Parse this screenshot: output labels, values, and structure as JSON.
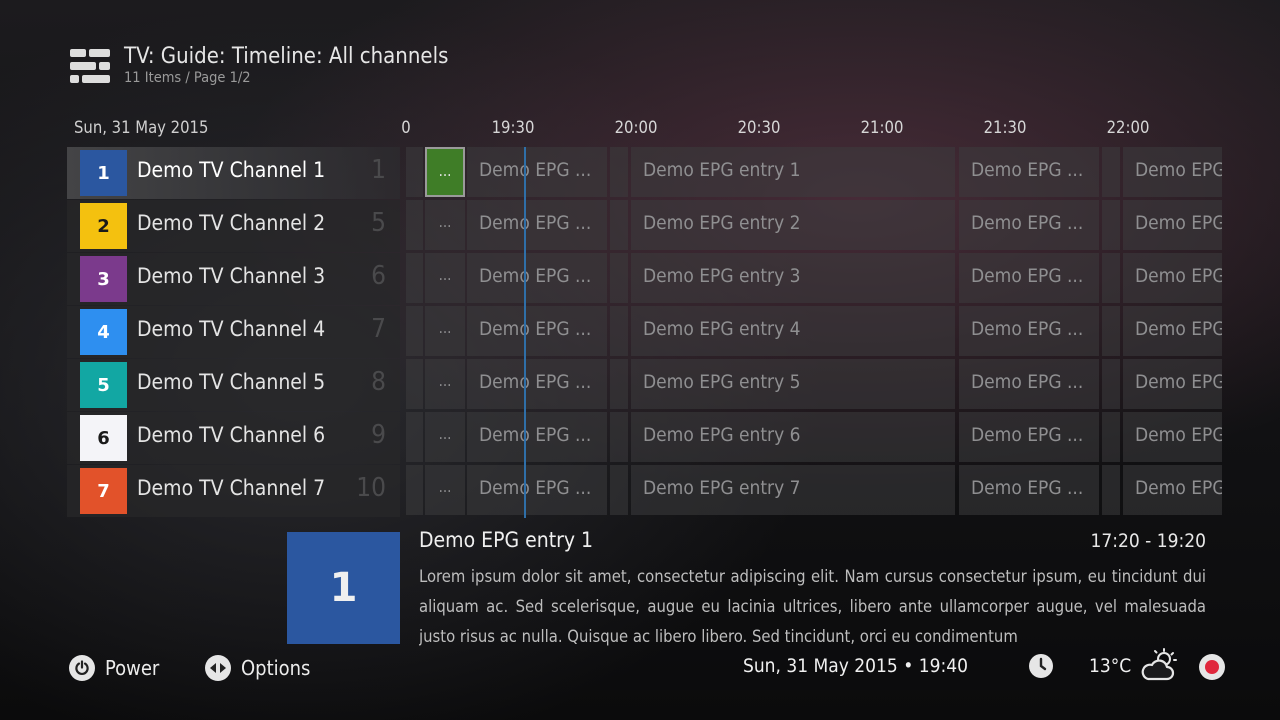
{
  "header": {
    "title": "TV: Guide: Timeline: All channels",
    "subtitle": "11 Items / Page 1/2",
    "icon": "guide-grid-icon"
  },
  "timeline": {
    "date": "Sun, 31 May 2015",
    "ticks": [
      "0",
      "19:30",
      "20:00",
      "20:30",
      "21:00",
      "21:30",
      "22:00"
    ]
  },
  "channels": [
    {
      "badge": "1",
      "name": "Demo TV Channel 1",
      "number": "1",
      "color": "#2b57a0",
      "badge_text_color": "#ffffff"
    },
    {
      "badge": "2",
      "name": "Demo TV Channel 2",
      "number": "5",
      "color": "#f4c10f",
      "badge_text_color": "#1a1a1a"
    },
    {
      "badge": "3",
      "name": "Demo TV Channel 3",
      "number": "6",
      "color": "#7b3a8c",
      "badge_text_color": "#ffffff"
    },
    {
      "badge": "4",
      "name": "Demo TV Channel 4",
      "number": "7",
      "color": "#2e8ff0",
      "badge_text_color": "#ffffff"
    },
    {
      "badge": "5",
      "name": "Demo TV Channel 5",
      "number": "8",
      "color": "#12a7a3",
      "badge_text_color": "#ffffff"
    },
    {
      "badge": "6",
      "name": "Demo TV Channel 6",
      "number": "9",
      "color": "#f4f4f8",
      "badge_text_color": "#1a1a1a"
    },
    {
      "badge": "7",
      "name": "Demo TV Channel 7",
      "number": "10",
      "color": "#e2522a",
      "badge_text_color": "#ffffff"
    }
  ],
  "epg_rows": [
    {
      "cells": [
        "...",
        "Demo EPG ...",
        "Demo EPG entry 1",
        "Demo EPG ...",
        "Demo EPG"
      ]
    },
    {
      "cells": [
        "...",
        "Demo EPG ...",
        "Demo EPG entry 2",
        "Demo EPG ...",
        "Demo EPG"
      ]
    },
    {
      "cells": [
        "...",
        "Demo EPG ...",
        "Demo EPG entry 3",
        "Demo EPG ...",
        "Demo EPG"
      ]
    },
    {
      "cells": [
        "...",
        "Demo EPG ...",
        "Demo EPG entry 4",
        "Demo EPG ...",
        "Demo EPG"
      ]
    },
    {
      "cells": [
        "...",
        "Demo EPG ...",
        "Demo EPG entry 5",
        "Demo EPG ...",
        "Demo EPG"
      ]
    },
    {
      "cells": [
        "...",
        "Demo EPG ...",
        "Demo EPG entry 6",
        "Demo EPG ...",
        "Demo EPG"
      ]
    },
    {
      "cells": [
        "...",
        "Demo EPG ...",
        "Demo EPG entry 7",
        "Demo EPG ...",
        "Demo EPG"
      ]
    }
  ],
  "info": {
    "thumb_label": "1",
    "title": "Demo EPG entry 1",
    "time": "17:20 - 19:20",
    "description": "Lorem ipsum dolor sit amet, consectetur adipiscing elit. Nam cursus consectetur ipsum, eu tincidunt dui aliquam ac. Sed scelerisque, augue eu lacinia ultrices, libero ante ullamcorper augue, vel malesuada justo risus ac nulla. Quisque ac libero libero. Sed tincidunt, orci eu condimentum"
  },
  "footer": {
    "power_label": "Power",
    "options_label": "Options",
    "datetime": "Sun, 31 May 2015 • 19:40",
    "temperature": "13°C",
    "icons": [
      "power-icon",
      "options-icon",
      "clock-icon",
      "weather-partly-cloudy-icon",
      "record-icon"
    ]
  },
  "colors": {
    "focus_green": "#3f7d27",
    "now_line": "#2f6fa8",
    "record_red": "#e0273c"
  }
}
